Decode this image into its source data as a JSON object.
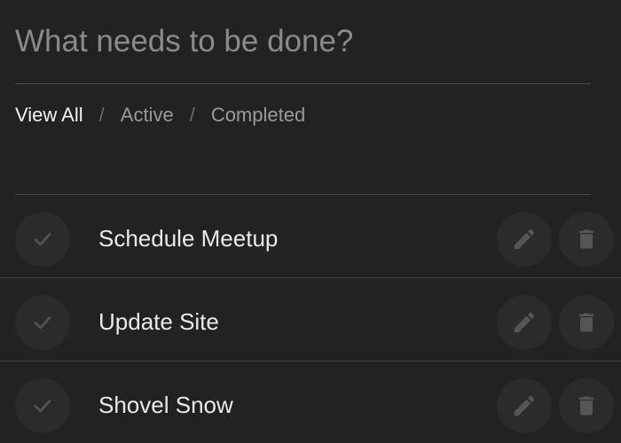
{
  "new_todo": {
    "placeholder": "What needs to be done?",
    "value": ""
  },
  "filters": [
    {
      "label": "View All",
      "active": true
    },
    {
      "label": "Active",
      "active": false
    },
    {
      "label": "Completed",
      "active": false
    }
  ],
  "filter_separator": "/",
  "todos": [
    {
      "text": "Schedule Meetup",
      "completed": false
    },
    {
      "text": "Update Site",
      "completed": false
    },
    {
      "text": "Shovel Snow",
      "completed": false
    }
  ],
  "icons": {
    "check": "check-icon",
    "edit": "pencil-icon",
    "delete": "trash-icon"
  },
  "colors": {
    "background": "#222222",
    "button_bg": "#2b2b2b",
    "icon": "#555555",
    "text": "#eaeaea",
    "muted": "#9a9a9a",
    "divider": "#3d3d3d"
  }
}
